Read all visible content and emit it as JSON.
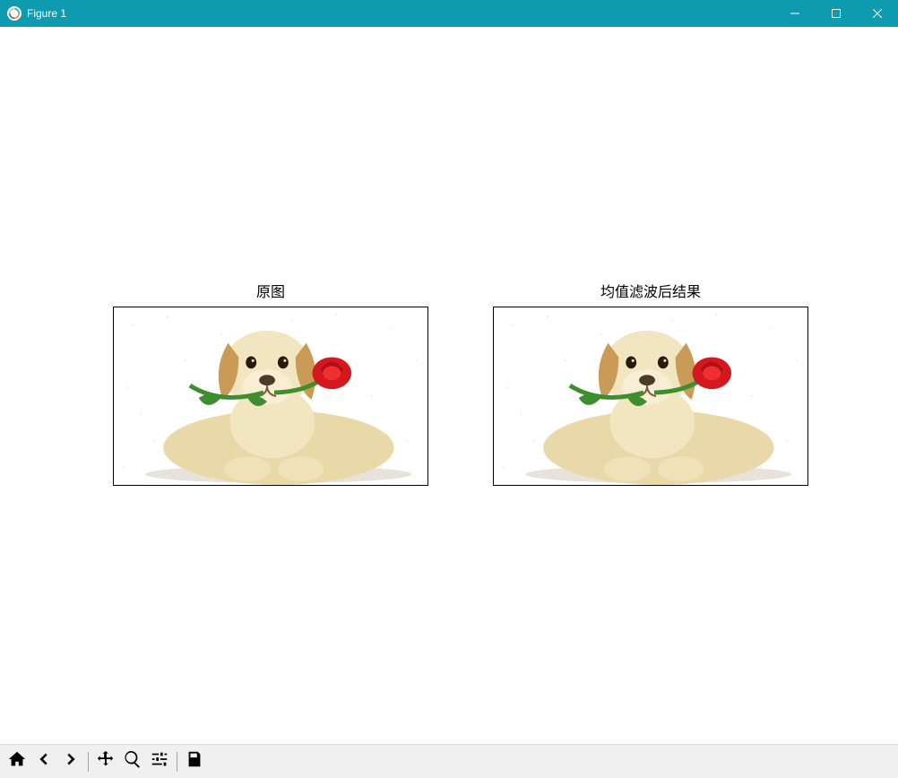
{
  "window": {
    "title": "Figure 1"
  },
  "figure": {
    "subplots": [
      {
        "title": "原图",
        "content_desc": "Puppy holding a red rose (with noise)"
      },
      {
        "title": "均值滤波后结果",
        "content_desc": "Puppy holding a red rose (mean-filtered)"
      }
    ]
  },
  "toolbar": {
    "buttons": [
      {
        "name": "home",
        "label": "Home"
      },
      {
        "name": "back",
        "label": "Back"
      },
      {
        "name": "forward",
        "label": "Forward"
      },
      {
        "name": "pan",
        "label": "Pan"
      },
      {
        "name": "zoom",
        "label": "Zoom"
      },
      {
        "name": "configure",
        "label": "Configure subplots"
      },
      {
        "name": "save",
        "label": "Save"
      }
    ]
  },
  "window_controls": {
    "minimize": "Minimize",
    "maximize": "Maximize",
    "close": "Close"
  }
}
